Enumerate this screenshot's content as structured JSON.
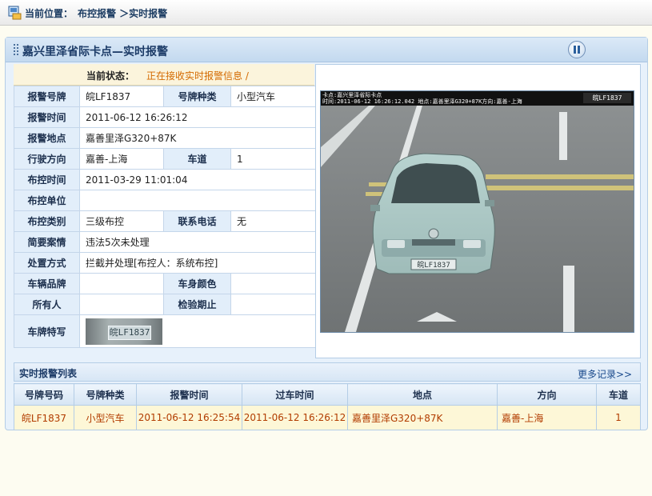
{
  "breadcrumb": {
    "label": "当前位置：",
    "path": "布控报警 ＞实时报警"
  },
  "panel": {
    "title": "嘉兴里泽省际卡点—实时报警"
  },
  "status": {
    "label": "当前状态：",
    "value": "正在接收实时报警信息  /"
  },
  "info": {
    "plate_number_label": "报警号牌",
    "plate_number": "皖LF1837",
    "plate_type_label": "号牌种类",
    "plate_type": "小型汽车",
    "alarm_time_label": "报警时间",
    "alarm_time": "2011-06-12 16:26:12",
    "alarm_place_label": "报警地点",
    "alarm_place": "嘉善里泽G320+87K",
    "direction_label": "行驶方向",
    "direction": "嘉善-上海",
    "lane_label": "车道",
    "lane": "1",
    "control_time_label": "布控时间",
    "control_time": "2011-03-29 11:01:04",
    "control_unit_label": "布控单位",
    "control_unit": "",
    "control_type_label": "布控类别",
    "control_type": "三级布控",
    "phone_label": "联系电话",
    "phone": "无",
    "case_label": "简要案情",
    "case": "违法5次未处理",
    "handling_label": "处置方式",
    "handling": "拦截并处理[布控人：系统布控]",
    "brand_label": "车辆品牌",
    "brand": "",
    "color_label": "车身颜色",
    "color": "",
    "owner_label": "所有人",
    "owner": "",
    "inspection_label": "检验期止",
    "inspection": "",
    "plate_closeup_label": "车牌特写",
    "plate_closeup_text": "皖LF1837"
  },
  "photo": {
    "caption": "卡点:嘉兴里泽省际卡点\n时间:2011-06-12 16:26:12.042 地点:嘉善里泽G320+87K方向:嘉善-上海",
    "plate_tag": "皖LF1837",
    "car_plate": "皖LF1837"
  },
  "list": {
    "title": "实时报警列表",
    "more": "更多记录>>",
    "columns": [
      "号牌号码",
      "号牌种类",
      "报警时间",
      "过车时间",
      "地点",
      "方向",
      "车道"
    ],
    "rows": [
      [
        "皖LF1837",
        "小型汽车",
        "2011-06-12 16:25:54",
        "2011-06-12 16:26:12",
        "嘉善里泽G320+87K",
        "嘉善-上海",
        "1"
      ]
    ]
  },
  "icons": {
    "breadcrumb": "location-icon",
    "panel": "grip-icon",
    "control": "pause-icon"
  },
  "colors": {
    "status_value": "#d46a00",
    "list_row_text": "#b23c00",
    "list_row_bg": "#fdf7d7",
    "header_text": "#1c3b67"
  }
}
